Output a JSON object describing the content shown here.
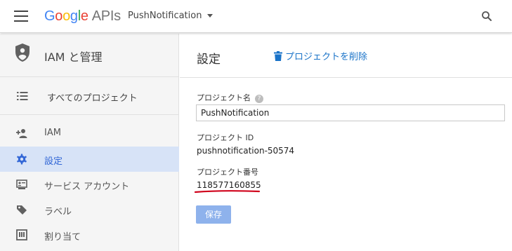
{
  "header": {
    "logo_google": "Google",
    "logo_apis": "APIs",
    "project_name": "PushNotification"
  },
  "sidebar": {
    "title": "IAM と管理",
    "all_projects": "すべてのプロジェクト",
    "items": [
      {
        "label": "IAM",
        "icon": "person-add-icon"
      },
      {
        "label": "設定",
        "icon": "gear-icon",
        "active": true
      },
      {
        "label": "サービス アカウント",
        "icon": "service-account-icon"
      },
      {
        "label": "ラベル",
        "icon": "label-icon"
      },
      {
        "label": "割り当て",
        "icon": "quota-icon"
      }
    ]
  },
  "main": {
    "title": "設定",
    "delete_label": "プロジェクトを削除",
    "project_name_label": "プロジェクト名",
    "project_name_value": "PushNotification",
    "project_id_label": "プロジェクト ID",
    "project_id_value": "pushnotification-50574",
    "project_number_label": "プロジェクト番号",
    "project_number_value": "118577160855",
    "save_label": "保存"
  },
  "colors": {
    "accent": "#1a73c8",
    "active_bg": "#d7e3f7",
    "save_disabled": "#8eb2ec",
    "annotation_red": "#d0021b"
  }
}
